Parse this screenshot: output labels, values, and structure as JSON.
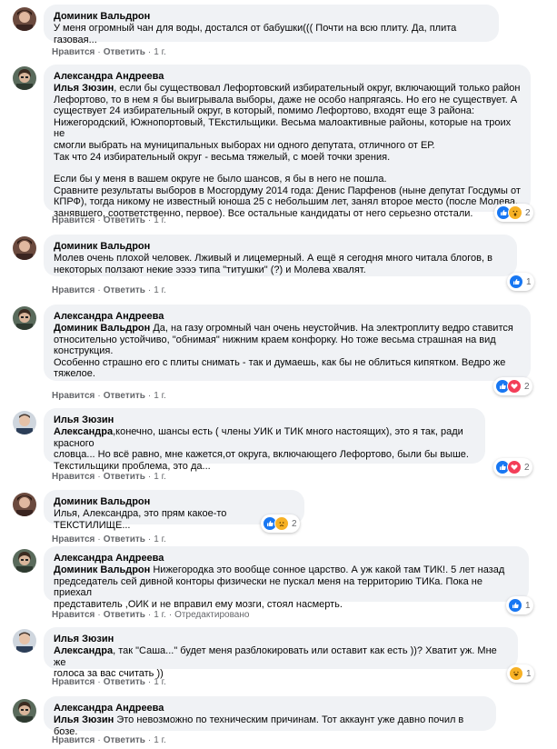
{
  "actions": {
    "like": "Нравится",
    "reply": "Ответить",
    "time": "1 г.",
    "edited": "Отредактировано"
  },
  "comments": [
    {
      "author": "Доминик Вальдрон",
      "text": "У меня огромный чан для воды, достался от бабушки((( Почти на всю плиту. Да, плита газовая..."
    },
    {
      "author": "Александра Андреева",
      "mention": "Илья Зюзин",
      "lines": [
        "Илья Зюзин, если бы существовал Лефортовский избирательный округ, включающий только район",
        "Лефортово, то в нем я бы выигрывала выборы, даже не особо напрягаясь. Но его не существует. А",
        "существует 24 избирательный округ, в который, помимо Лефортово, входят еще 3 района:",
        "Нижегородский, Южнопортовый, ТЕкстильщики. Весьма малоактивные районы, которые на троих не",
        "смогли выбрать на муниципальных выборах ни одного депутата, отличного от ЕР.",
        "Так что 24 избирательный округ - весьма тяжелый, с моей точки зрения.",
        "",
        "Если бы у меня в вашем округе не было шансов, я бы в него не пошла.",
        "Сравните результаты выборов в Мосгордуму 2014 года: Денис Парфенов (ныне депутат Госдумы от",
        "КПРФ), тогда никому не известный юноша 25 с небольшим лет, занял второе место (после Молева,",
        "занявшего, соответственно, первое). Все остальные кандидаты от него серьезно отстали."
      ],
      "reaction_count": "2"
    },
    {
      "author": "Доминик Вальдрон",
      "lines": [
        "Молев очень плохой человек. Лживый и лицемерный. А ещё я сегодня много читала блогов, в",
        "некоторых ползают некие ээээ типа \"титушки\" (?) и Молева хвалят."
      ],
      "reaction_count": "1"
    },
    {
      "author": "Александра Андреева",
      "mention": "Доминик Вальдрон",
      "lines": [
        "Доминик Вальдрон Да, на газу огромный чан очень неустойчив. На электроплиту ведро ставится",
        "относительно устойчиво, \"обнимая\" нижним краем конфорку. Но тоже весьма страшная на вид",
        "конструкция.",
        "Особенно страшно его с плиты снимать - так и думаешь, как бы не облиться кипятком. Ведро же",
        "тяжелое."
      ],
      "reaction_count": "2"
    },
    {
      "author": "Илья Зюзин",
      "mention": "Александра",
      "lines": [
        "Александра,конечно, шансы есть ( члены УИК и ТИК много настоящих), это я так, ради красного",
        "словца... Но всё равно, мне кажется,от округа, включающего Лефортово, были бы выше.",
        "Текстильщики проблема, это да..."
      ],
      "reaction_count": "2"
    },
    {
      "author": "Доминик Вальдрон",
      "text": "Илья, Александра, это прям какое-то ТЕКСТИЛИЩЕ...",
      "reaction_count": "2"
    },
    {
      "author": "Александра Андреева",
      "mention": "Доминик Вальдрон",
      "lines": [
        "Доминик Вальдрон Нижегородка это вообще сонное царство. А уж какой там ТИК!. 5 лет назад",
        "председатель сей дивной конторы физически не пускал меня на территорию ТИКа. Пока не приехал",
        "представитель ,ОИК и не вправил ему мозги, стоял насмерть."
      ],
      "reaction_count": "1"
    },
    {
      "author": "Илья Зюзин",
      "mention": "Александра",
      "lines": [
        "Александра, так \"Саша...\" будет меня разблокировать или оставит как есть ))? Хватит уж. Мне же",
        "голоса за вас считать ))"
      ],
      "reaction_count": "1"
    },
    {
      "author": "Александра Андреева",
      "mention": "Илья Зюзин",
      "lines": [
        "Илья Зюзин Это невозможно по техническим причинам. Тот аккаунт уже давно почил в бозе."
      ]
    }
  ]
}
